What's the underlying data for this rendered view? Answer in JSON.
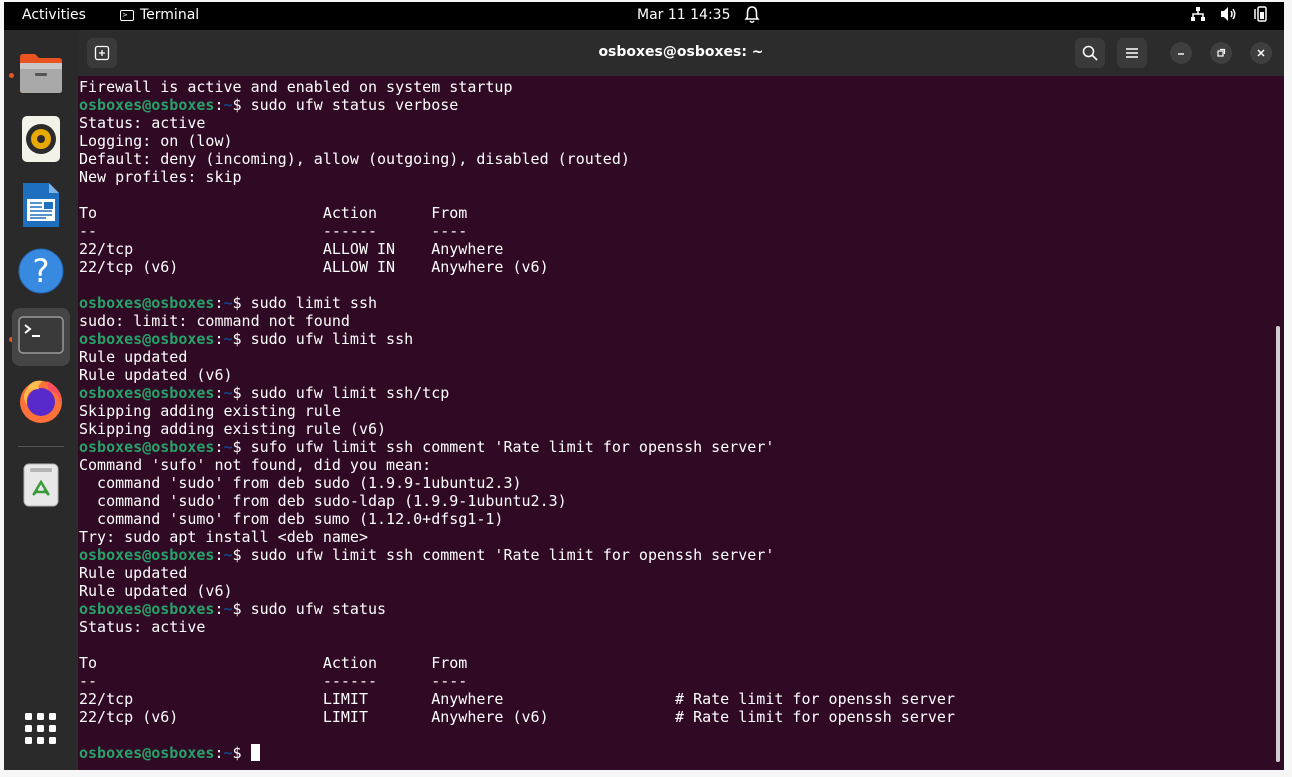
{
  "topbar": {
    "activities": "Activities",
    "app_name": "Terminal",
    "clock": "Mar 11  14:35"
  },
  "window": {
    "title": "osboxes@osboxes: ~"
  },
  "dock": {
    "items": [
      "files-icon",
      "rhythmbox-icon",
      "writer-icon",
      "help-icon",
      "terminal-icon",
      "firefox-icon",
      "trash-icon",
      "show-apps-icon"
    ]
  },
  "terminal": {
    "lines": [
      {
        "text": "Firewall is active and enabled on system startup"
      },
      {
        "user": "osboxes@osboxes",
        "path": "~",
        "cmd": "sudo ufw status verbose"
      },
      {
        "text": "Status: active"
      },
      {
        "text": "Logging: on (low)"
      },
      {
        "text": "Default: deny (incoming), allow (outgoing), disabled (routed)"
      },
      {
        "text": "New profiles: skip"
      },
      {
        "text": ""
      },
      {
        "text": "To                         Action      From"
      },
      {
        "text": "--                         ------      ----"
      },
      {
        "text": "22/tcp                     ALLOW IN    Anywhere"
      },
      {
        "text": "22/tcp (v6)                ALLOW IN    Anywhere (v6)"
      },
      {
        "text": ""
      },
      {
        "user": "osboxes@osboxes",
        "path": "~",
        "cmd": "sudo limit ssh"
      },
      {
        "text": "sudo: limit: command not found"
      },
      {
        "user": "osboxes@osboxes",
        "path": "~",
        "cmd": "sudo ufw limit ssh"
      },
      {
        "text": "Rule updated"
      },
      {
        "text": "Rule updated (v6)"
      },
      {
        "user": "osboxes@osboxes",
        "path": "~",
        "cmd": "sudo ufw limit ssh/tcp"
      },
      {
        "text": "Skipping adding existing rule"
      },
      {
        "text": "Skipping adding existing rule (v6)"
      },
      {
        "user": "osboxes@osboxes",
        "path": "~",
        "cmd": "sufo ufw limit ssh comment 'Rate limit for openssh server'"
      },
      {
        "text": "Command 'sufo' not found, did you mean:"
      },
      {
        "text": "  command 'sudo' from deb sudo (1.9.9-1ubuntu2.3)"
      },
      {
        "text": "  command 'sudo' from deb sudo-ldap (1.9.9-1ubuntu2.3)"
      },
      {
        "text": "  command 'sumo' from deb sumo (1.12.0+dfsg1-1)"
      },
      {
        "text": "Try: sudo apt install <deb name>"
      },
      {
        "user": "osboxes@osboxes",
        "path": "~",
        "cmd": "sudo ufw limit ssh comment 'Rate limit for openssh server'"
      },
      {
        "text": "Rule updated"
      },
      {
        "text": "Rule updated (v6)"
      },
      {
        "user": "osboxes@osboxes",
        "path": "~",
        "cmd": "sudo ufw status"
      },
      {
        "text": "Status: active"
      },
      {
        "text": ""
      },
      {
        "text": "To                         Action      From"
      },
      {
        "text": "--                         ------      ----"
      },
      {
        "text": "22/tcp                     LIMIT       Anywhere                   # Rate limit for openssh server"
      },
      {
        "text": "22/tcp (v6)                LIMIT       Anywhere (v6)              # Rate limit for openssh server"
      },
      {
        "text": ""
      },
      {
        "user": "osboxes@osboxes",
        "path": "~",
        "cmd": "",
        "cursor": true
      }
    ]
  },
  "colors": {
    "terminal_bg": "#300a24",
    "prompt_user": "#26a269",
    "prompt_path": "#12488b",
    "accent": "#e95420"
  }
}
